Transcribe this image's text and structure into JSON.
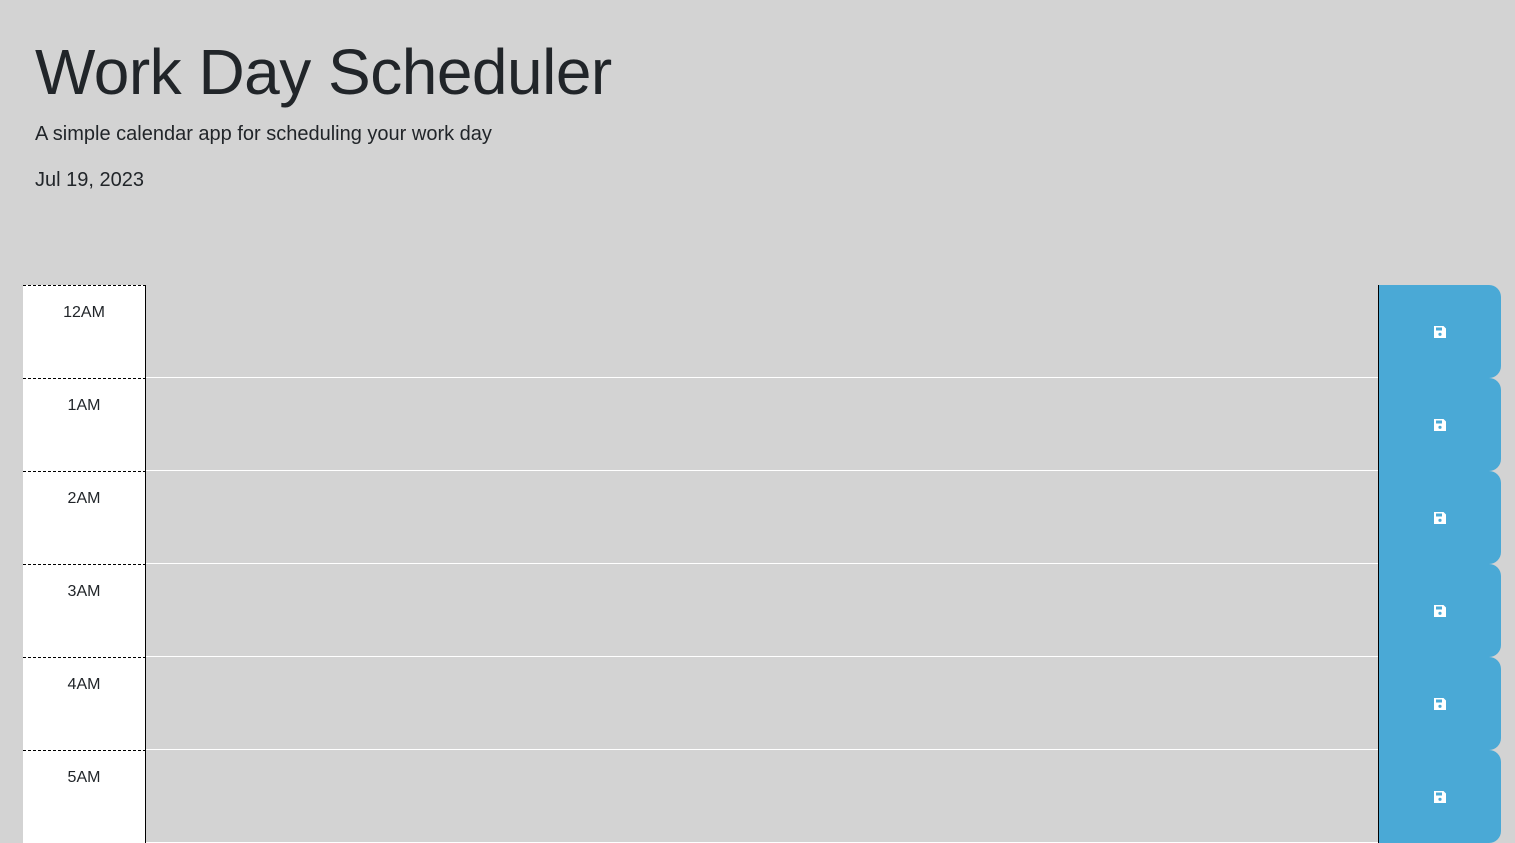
{
  "header": {
    "title": "Work Day Scheduler",
    "subtitle": "A simple calendar app for scheduling your work day",
    "current_day": "Jul 19, 2023"
  },
  "time_blocks": [
    {
      "hour": "12AM",
      "description": ""
    },
    {
      "hour": "1AM",
      "description": ""
    },
    {
      "hour": "2AM",
      "description": ""
    },
    {
      "hour": "3AM",
      "description": ""
    },
    {
      "hour": "4AM",
      "description": ""
    },
    {
      "hour": "5AM",
      "description": ""
    }
  ],
  "icons": {
    "save": "save-icon"
  },
  "colors": {
    "page_background": "#d3d3d3",
    "hour_background": "#ffffff",
    "save_button": "#4aa9d6",
    "save_icon": "#ffffff"
  }
}
